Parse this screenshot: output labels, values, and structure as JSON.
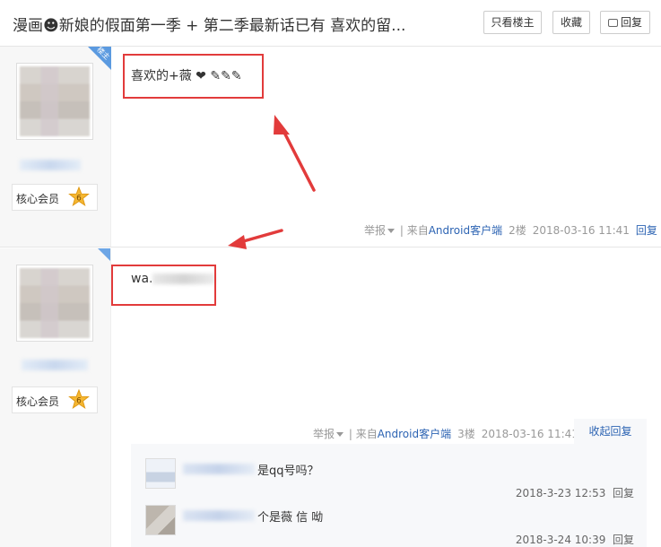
{
  "header": {
    "title": "漫画☻新娘的假面第一季 + 第二季最新话已有 喜欢的留...",
    "only_op_label": "只看楼主",
    "favorite_label": "收藏",
    "reply_label": "回复"
  },
  "posts": [
    {
      "op_tag": "楼主",
      "rank_label": "核心会员",
      "rank_level": "6",
      "content": "喜欢的+薇 ❤ ✎✎✎",
      "report_label": "举报",
      "source_prefix": "| 来自",
      "source_app": "Android客户端",
      "floor": "2楼",
      "time": "2018-03-16 11:41",
      "reply_label": "回复"
    },
    {
      "rank_label": "核心会员",
      "rank_level": "6",
      "content_prefix": "wa.",
      "report_label": "举报",
      "source_prefix": "| 来自",
      "source_app": "Android客户端",
      "floor": "3楼",
      "time": "2018-03-16 11:41",
      "collapse_label": "收起回复",
      "comments": [
        {
          "text": "是qq号吗？",
          "time": "2018-3-23 12:53",
          "reply_label": "回复",
          "avatar": "default-avatar"
        },
        {
          "text": "个是薇 信 呦",
          "time": "2018-3-24 10:39",
          "reply_label": "回复",
          "avatar": "photo-avatar"
        }
      ]
    }
  ],
  "colors": {
    "annotation_red": "#e23b3b",
    "link_blue": "#2d64b3",
    "op_tag_blue": "#5b9ae0"
  }
}
